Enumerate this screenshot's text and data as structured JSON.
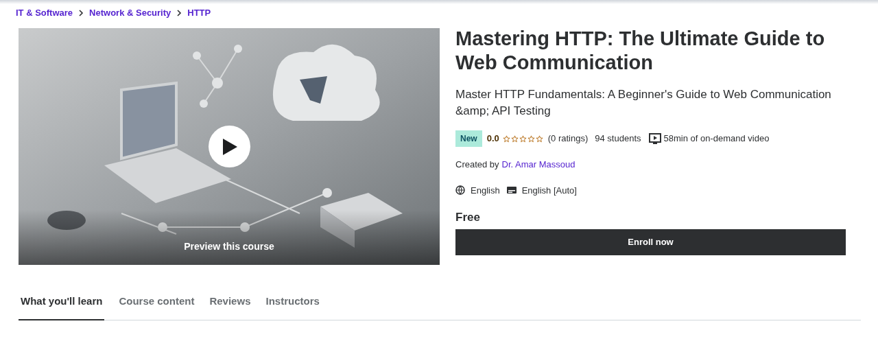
{
  "breadcrumb": [
    "IT & Software",
    "Network & Security",
    "HTTP"
  ],
  "preview": {
    "label": "Preview this course"
  },
  "course": {
    "title": "Mastering HTTP: The Ultimate Guide to Web Communication",
    "subtitle": "Master HTTP Fundamentals: A Beginner's Guide to Web Communication &amp; API Testing",
    "badge": "New",
    "rating": "0.0",
    "stars": 0,
    "ratings_count": "(0 ratings)",
    "students": "94 students",
    "video": "58min of on-demand video",
    "created_by": "Created by",
    "instructor": "Dr. Amar Massoud",
    "language": "English",
    "captions": "English [Auto]",
    "price": "Free",
    "enroll": "Enroll now"
  },
  "tabs": [
    {
      "label": "What you'll learn",
      "selected": true
    },
    {
      "label": "Course content",
      "selected": false
    },
    {
      "label": "Reviews",
      "selected": false
    },
    {
      "label": "Instructors",
      "selected": false
    }
  ]
}
